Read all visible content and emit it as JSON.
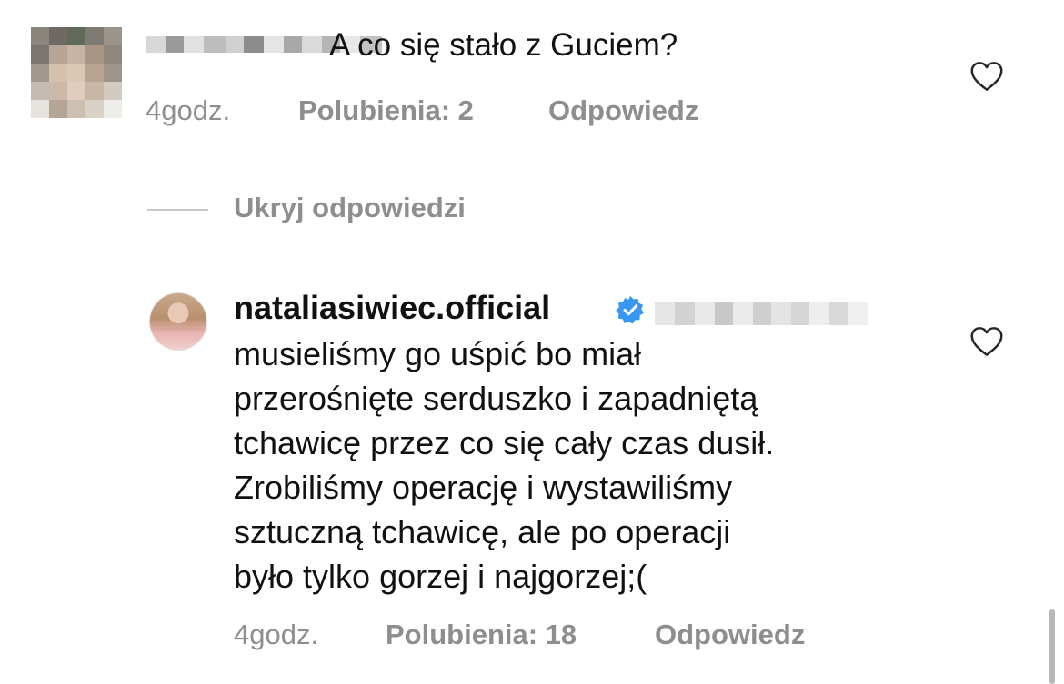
{
  "comment": {
    "text": "A co się stało z Guciem?",
    "time": "4godz.",
    "likes": "Polubienia: 2",
    "reply": "Odpowiedz",
    "avatar_icon": "blurred-avatar",
    "heart_icon": "heart-outline-icon"
  },
  "hide_replies": "Ukryj odpowiedzi",
  "reply": {
    "username": "nataliasiwiec.official",
    "verified_icon": "verified-badge-icon",
    "lines": [
      "musieliśmy go uśpić bo miał",
      "przerośnięte serduszko i zapadniętą",
      "tchawicę przez co się cały czas dusił.",
      "Zrobiliśmy operację i wystawiliśmy",
      "sztuczną tchawicę, ale po operacji",
      "było tylko gorzej i najgorzej;("
    ],
    "time": "4godz.",
    "likes": "Polubienia: 18",
    "reply": "Odpowiedz",
    "heart_icon": "heart-outline-icon"
  },
  "colors": {
    "secondary_text": "#8e8e8e",
    "verified_blue": "#3897f0",
    "divider": "#c7c7c7"
  }
}
